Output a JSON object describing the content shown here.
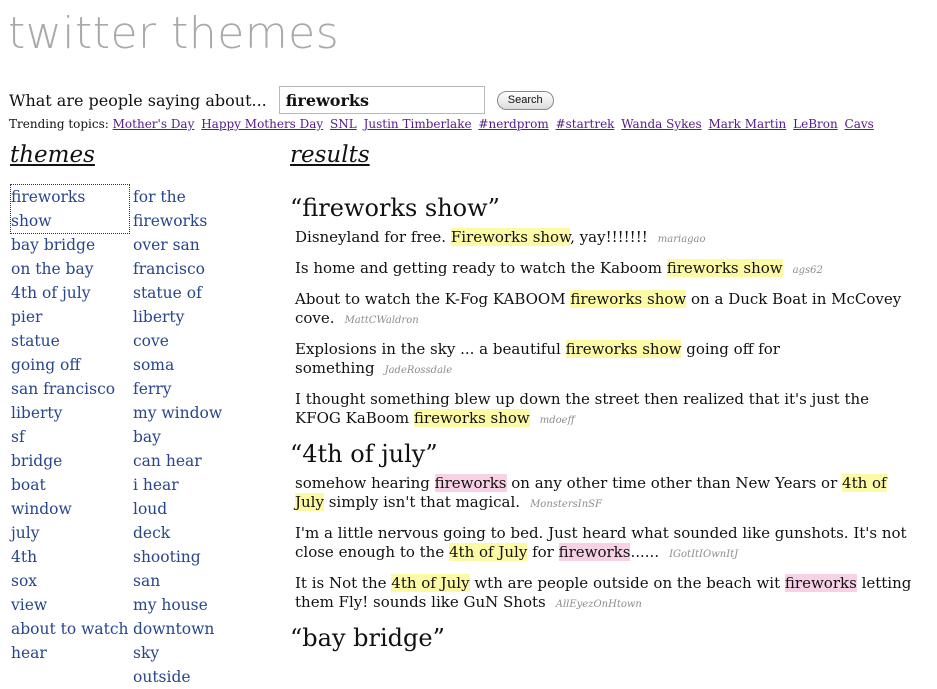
{
  "app": {
    "title": "twitter themes"
  },
  "search": {
    "label": "What are people saying about...",
    "value": "fireworks",
    "button": "Search"
  },
  "trending": {
    "label": "Trending topics:",
    "topics": [
      "Mother's Day",
      "Happy Mothers Day",
      "SNL",
      "Justin Timberlake",
      "#nerdprom",
      "#startrek",
      "Wanda Sykes",
      "Mark Martin",
      "LeBron",
      "Cavs"
    ]
  },
  "themes": {
    "heading": "themes",
    "col1": [
      "fireworks show",
      "bay bridge",
      "on the bay",
      "4th of july",
      "pier",
      "statue",
      "going off",
      "san francisco",
      "liberty",
      "sf",
      "bridge",
      "boat",
      "window",
      "july",
      "4th",
      "sox",
      "view",
      "about to watch",
      "hear"
    ],
    "col2": [
      "for the fireworks",
      "over san francisco",
      "statue of liberty",
      "cove",
      "soma",
      "ferry",
      "my window",
      "bay",
      "can hear",
      "i hear",
      "loud",
      "deck",
      "shooting",
      "san",
      "my house",
      "downtown",
      "sky",
      "outside"
    ]
  },
  "results": {
    "heading": "results",
    "groups": [
      {
        "title": "“fireworks show”",
        "tweets": [
          {
            "parts": [
              {
                "t": "Disneyland for free. "
              },
              {
                "t": "Fireworks show",
                "h": "theme"
              },
              {
                "t": ", yay!!!!!!!"
              }
            ],
            "author": "mariagao"
          },
          {
            "parts": [
              {
                "t": "Is home and getting ready to watch the Kaboom "
              },
              {
                "t": "fireworks show",
                "h": "theme"
              }
            ],
            "author": "ags62"
          },
          {
            "parts": [
              {
                "t": "About to watch the K-Fog KABOOM "
              },
              {
                "t": "fireworks show",
                "h": "theme"
              },
              {
                "t": " on a Duck Boat in McCovey cove."
              }
            ],
            "author": "MattCWaldron"
          },
          {
            "parts": [
              {
                "t": "Explosions in the sky ... a beautiful "
              },
              {
                "t": "fireworks show",
                "h": "theme"
              },
              {
                "t": " going off for something"
              }
            ],
            "author": "JadeRossdale"
          },
          {
            "parts": [
              {
                "t": "I thought something blew up down the street then realized that it's just the KFOG KaBoom "
              },
              {
                "t": "fireworks show",
                "h": "theme"
              }
            ],
            "author": "mdoeff"
          }
        ]
      },
      {
        "title": "“4th of july”",
        "tweets": [
          {
            "parts": [
              {
                "t": "somehow hearing "
              },
              {
                "t": "fireworks",
                "h": "query"
              },
              {
                "t": " on any other time other than New Years or "
              },
              {
                "t": "4th of July",
                "h": "theme"
              },
              {
                "t": " simply isn't that magical."
              }
            ],
            "author": "MonstersInSF"
          },
          {
            "parts": [
              {
                "t": "I'm a little nervous going to bed. Just heard what sounded like gunshots. It's not close enough to the "
              },
              {
                "t": "4th of July",
                "h": "theme"
              },
              {
                "t": " for "
              },
              {
                "t": "fireworks",
                "h": "query"
              },
              {
                "t": "......"
              }
            ],
            "author": "IGotItIOwnItJ"
          },
          {
            "parts": [
              {
                "t": "It is Not the "
              },
              {
                "t": "4th of July",
                "h": "theme"
              },
              {
                "t": " wth are people outside on the beach wit "
              },
              {
                "t": "fireworks",
                "h": "query"
              },
              {
                "t": " letting them Fly! sounds like GuN Shots"
              }
            ],
            "author": "AllEyezOnHtown"
          }
        ]
      },
      {
        "title": "“bay bridge”",
        "tweets": []
      }
    ]
  },
  "colors": {
    "logo": "#a9a9a9",
    "theme_link": "#27468c",
    "trend_link": "#551a8b",
    "highlight_theme": "#fdfaa6",
    "highlight_query": "#f7d2e6",
    "author": "#8d8d8d"
  }
}
